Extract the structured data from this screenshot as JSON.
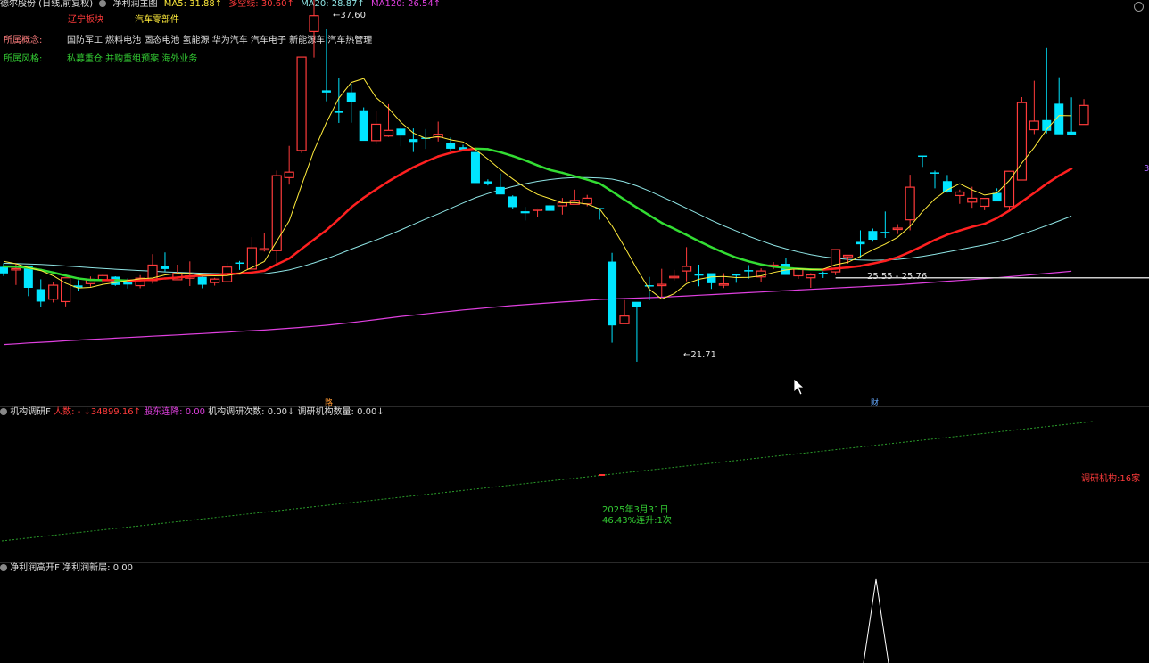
{
  "header": {
    "stock": "德尔股份 (日线,前复权)",
    "indicator": "净利润主图",
    "ma5": "MA5: 31.88↑",
    "duokong": "多空线: 30.60↑",
    "ma20": "MA20: 28.87↑",
    "ma120": "MA120: 26.54↑"
  },
  "tags": {
    "region": "辽宁板块",
    "industry": "汽车零部件"
  },
  "concepts": {
    "label": "所属概念:",
    "value": "国防军工 燃料电池 固态电池 氢能源 华为汽车 汽车电子 新能源车 汽车热管理"
  },
  "styles": {
    "label": "所属风格:",
    "value": "私募重仓 并购重组预案 海外业务"
  },
  "price_labels": {
    "high": "37.60",
    "low": "21.71",
    "range": "25.55 - 25.76",
    "right_axis": "3"
  },
  "markers": {
    "m1": "路",
    "m2": "财"
  },
  "panel2": {
    "title": "机构调研F",
    "renshu": "人数: - ↓34899.16↑",
    "reduce": "股东连降: 0.00",
    "count": "机构调研次数: 0.00↓",
    "num": "调研机构数量: 0.00↓",
    "date": "2025年3月31日",
    "rise": "46.43%连升:1次",
    "inst": "调研机构:16家"
  },
  "panel3": {
    "title": "净利润高开F",
    "value": "净利润新层: 0.00"
  },
  "colors": {
    "up": "#ff3b3b",
    "down": "#00e5ff",
    "ma5": "#ffeb3b",
    "ma10": "#ff2020",
    "ma10_down": "#33dd33",
    "ma20": "#8fe5e5",
    "ma120": "#e040e0"
  },
  "chart_data": {
    "type": "candlestick",
    "candles": [
      [
        26.05,
        26.22,
        25.63,
        25.75
      ],
      [
        25.91,
        26.18,
        25.22,
        25.97
      ],
      [
        26.11,
        26.11,
        24.71,
        25.09
      ],
      [
        25.03,
        25.48,
        24.2,
        24.46
      ],
      [
        24.57,
        25.36,
        24.42,
        25.21
      ],
      [
        24.46,
        25.51,
        24.24,
        25.55
      ],
      [
        25.2,
        25.44,
        24.94,
        25.11
      ],
      [
        25.28,
        25.61,
        25.14,
        25.48
      ],
      [
        25.46,
        25.74,
        25.26,
        25.65
      ],
      [
        25.6,
        25.62,
        25.18,
        25.22
      ],
      [
        25.35,
        25.52,
        25.06,
        25.24
      ],
      [
        25.19,
        25.67,
        25.07,
        25.53
      ],
      [
        25.42,
        26.63,
        25.28,
        26.13
      ],
      [
        26.08,
        26.71,
        25.83,
        25.95
      ],
      [
        25.46,
        26.15,
        25.46,
        25.75
      ],
      [
        25.53,
        26.3,
        25.17,
        25.63
      ],
      [
        25.59,
        25.72,
        25.07,
        25.23
      ],
      [
        25.33,
        25.55,
        25.19,
        25.49
      ],
      [
        25.37,
        26.24,
        25.35,
        26.04
      ],
      [
        26.25,
        26.32,
        25.91,
        26.23
      ],
      [
        25.95,
        27.41,
        25.95,
        26.92
      ],
      [
        26.86,
        27.61,
        26.75,
        26.88
      ],
      [
        26.79,
        30.45,
        26.17,
        30.22
      ],
      [
        30.13,
        31.58,
        29.81,
        30.38
      ],
      [
        31.37,
        34.58,
        31.26,
        35.64
      ],
      [
        36.81,
        38.4,
        35.62,
        37.53
      ],
      [
        34.12,
        36.93,
        33.62,
        34.02
      ],
      [
        33.18,
        34.69,
        32.63,
        33.09
      ],
      [
        34.03,
        34.42,
        32.64,
        33.59
      ],
      [
        33.21,
        33.34,
        31.85,
        31.81
      ],
      [
        31.82,
        33.18,
        31.66,
        32.57
      ],
      [
        32.03,
        33.49,
        31.99,
        32.29
      ],
      [
        32.37,
        32.76,
        31.56,
        32.05
      ],
      [
        31.89,
        32.38,
        31.3,
        31.76
      ],
      [
        31.96,
        32.35,
        31.44,
        31.91
      ],
      [
        31.98,
        32.69,
        31.78,
        32.11
      ],
      [
        31.72,
        31.97,
        31.33,
        31.45
      ],
      [
        31.52,
        31.63,
        31.44,
        31.36
      ],
      [
        31.3,
        31.3,
        29.95,
        29.88
      ],
      [
        29.96,
        30.05,
        29.77,
        29.86
      ],
      [
        29.7,
        30.32,
        29.37,
        29.36
      ],
      [
        29.27,
        29.32,
        28.68,
        28.78
      ],
      [
        28.59,
        28.79,
        28.17,
        28.5
      ],
      [
        28.65,
        28.72,
        28.31,
        28.69
      ],
      [
        28.86,
        28.97,
        28.54,
        28.61
      ],
      [
        28.84,
        29.2,
        28.44,
        28.98
      ],
      [
        28.91,
        29.58,
        28.99,
        29.09
      ],
      [
        28.93,
        29.34,
        28.82,
        29.19
      ],
      [
        28.74,
        28.71,
        28.21,
        28.71
      ],
      [
        26.29,
        26.69,
        22.58,
        23.37
      ],
      [
        23.45,
        24.53,
        23.48,
        23.8
      ],
      [
        24.45,
        24.33,
        21.71,
        24.2
      ],
      [
        25.21,
        25.59,
        24.52,
        25.19
      ],
      [
        25.2,
        25.96,
        24.68,
        25.25
      ],
      [
        25.57,
        25.91,
        25.43,
        25.61
      ],
      [
        25.86,
        26.95,
        25.39,
        26.07
      ],
      [
        25.71,
        26.15,
        25.16,
        25.65
      ],
      [
        25.76,
        25.68,
        25.04,
        25.3
      ],
      [
        25.23,
        25.76,
        25.08,
        25.27
      ],
      [
        25.71,
        25.7,
        25.32,
        25.69
      ],
      [
        25.9,
        26.13,
        25.51,
        25.89
      ],
      [
        25.59,
        25.98,
        25.35,
        25.86
      ],
      [
        26.11,
        26.27,
        25.94,
        26.13
      ],
      [
        26.19,
        26.44,
        25.8,
        25.68
      ],
      [
        25.64,
        25.87,
        25.5,
        25.96
      ],
      [
        25.55,
        25.76,
        25.09,
        25.68
      ],
      [
        25.78,
        25.84,
        25.54,
        25.72
      ],
      [
        25.82,
        26.7,
        25.67,
        26.84
      ],
      [
        26.51,
        26.56,
        26.2,
        26.58
      ],
      [
        27.19,
        27.72,
        26.44,
        27.08
      ],
      [
        27.69,
        27.8,
        27.2,
        27.29
      ],
      [
        27.65,
        28.58,
        27.37,
        27.63
      ],
      [
        27.82,
        28.0,
        27.55,
        27.82
      ],
      [
        28.2,
        30.26,
        27.72,
        29.69
      ],
      [
        31.14,
        31.1,
        30.62,
        31.08
      ],
      [
        30.37,
        30.45,
        29.64,
        30.32
      ],
      [
        29.97,
        30.25,
        29.44,
        29.45
      ],
      [
        29.31,
        29.58,
        28.93,
        29.47
      ],
      [
        29.01,
        29.71,
        28.75,
        29.19
      ],
      [
        28.82,
        29.17,
        28.64,
        29.18
      ],
      [
        29.43,
        29.64,
        29.52,
        29.04
      ],
      [
        28.81,
        30.26,
        28.63,
        30.42
      ],
      [
        30.02,
        33.81,
        30.05,
        33.56
      ],
      [
        32.32,
        34.56,
        32.12,
        32.71
      ],
      [
        32.76,
        36.06,
        32.15,
        32.27
      ],
      [
        33.51,
        34.72,
        32.17,
        32.11
      ],
      [
        32.23,
        33.8,
        32.07,
        32.1
      ],
      [
        32.56,
        33.72,
        32.66,
        33.43
      ]
    ],
    "ma5": [
      26.3,
      26.19,
      26.01,
      25.88,
      25.64,
      25.3,
      25.08,
      25.11,
      25.25,
      25.33,
      25.43,
      25.5,
      25.54,
      25.68,
      25.75,
      25.75,
      25.66,
      25.64,
      25.65,
      25.76,
      26.02,
      26.29,
      27.22,
      28.15,
      29.79,
      31.37,
      32.65,
      33.76,
      34.48,
      34.66,
      33.79,
      33.3,
      32.66,
      32.17,
      31.92,
      32.01,
      31.86,
      31.76,
      31.41,
      30.98,
      30.5,
      30.07,
      29.68,
      29.36,
      29.17,
      28.98,
      28.99,
      28.92,
      28.7,
      27.92,
      26.97,
      25.95,
      25.03,
      24.58,
      24.82,
      25.28,
      25.48,
      25.59,
      25.61,
      25.56,
      25.57,
      25.64,
      25.79,
      25.91,
      25.96,
      25.93,
      25.94,
      26.15,
      26.26,
      26.53,
      26.83,
      27.09,
      27.4,
      27.9,
      28.58,
      29.16,
      29.57,
      29.85,
      29.57,
      29.33,
      29.43,
      30.0,
      30.79,
      31.51,
      32.33,
      32.97,
      32.96
    ],
    "ma10": [
      26.07,
      26.06,
      26.0,
      25.91,
      25.79,
      25.65,
      25.52,
      25.45,
      25.44,
      25.44,
      25.42,
      25.43,
      25.46,
      25.52,
      25.56,
      25.62,
      25.65,
      25.68,
      25.72,
      25.74,
      25.79,
      25.87,
      26.16,
      26.43,
      26.87,
      27.3,
      27.73,
      28.23,
      28.77,
      29.21,
      29.59,
      29.96,
      30.29,
      30.6,
      30.86,
      31.1,
      31.26,
      31.38,
      31.45,
      31.43,
      31.29,
      31.12,
      30.92,
      30.69,
      30.48,
      30.35,
      30.19,
      30.04,
      29.86,
      29.5,
      29.12,
      28.76,
      28.41,
      28.06,
      27.79,
      27.51,
      27.22,
      26.95,
      26.7,
      26.47,
      26.3,
      26.16,
      26.06,
      26.0,
      25.96,
      25.93,
      25.92,
      25.97,
      26.02,
      26.09,
      26.2,
      26.32,
      26.49,
      26.73,
      27.0,
      27.28,
      27.52,
      27.71,
      27.88,
      28.02,
      28.28,
      28.62,
      29.03,
      29.43,
      29.85,
      30.22,
      30.54
    ],
    "ma20": [
      26.21,
      26.2,
      26.18,
      26.16,
      26.13,
      26.09,
      26.05,
      26.01,
      25.98,
      25.94,
      25.91,
      25.88,
      25.85,
      25.82,
      25.8,
      25.78,
      25.76,
      25.74,
      25.73,
      25.72,
      25.72,
      25.73,
      25.81,
      25.91,
      26.06,
      26.23,
      26.42,
      26.63,
      26.86,
      27.07,
      27.28,
      27.5,
      27.74,
      27.99,
      28.24,
      28.47,
      28.72,
      28.97,
      29.21,
      29.4,
      29.57,
      29.72,
      29.85,
      29.96,
      30.04,
      30.1,
      30.13,
      30.13,
      30.11,
      30.06,
      29.94,
      29.75,
      29.52,
      29.26,
      29.0,
      28.73,
      28.46,
      28.18,
      27.92,
      27.69,
      27.45,
      27.24,
      27.04,
      26.88,
      26.73,
      26.61,
      26.51,
      26.44,
      26.39,
      26.36,
      26.35,
      26.36,
      26.39,
      26.45,
      26.53,
      26.62,
      26.73,
      26.84,
      26.95,
      27.06,
      27.18,
      27.35,
      27.54,
      27.73,
      27.94,
      28.15,
      28.37
    ],
    "ma120": [
      22.5,
      22.53,
      22.57,
      22.6,
      22.63,
      22.67,
      22.7,
      22.73,
      22.76,
      22.79,
      22.82,
      22.85,
      22.88,
      22.91,
      22.94,
      22.97,
      23.0,
      23.03,
      23.06,
      23.1,
      23.13,
      23.16,
      23.2,
      23.24,
      23.28,
      23.33,
      23.38,
      23.44,
      23.5,
      23.57,
      23.64,
      23.71,
      23.78,
      23.84,
      23.9,
      23.96,
      24.02,
      24.08,
      24.13,
      24.18,
      24.23,
      24.28,
      24.32,
      24.36,
      24.4,
      24.44,
      24.48,
      24.52,
      24.56,
      24.58,
      24.6,
      24.62,
      24.64,
      24.66,
      24.69,
      24.72,
      24.75,
      24.78,
      24.81,
      24.84,
      24.87,
      24.9,
      24.93,
      24.96,
      24.99,
      25.02,
      25.05,
      25.08,
      25.11,
      25.14,
      25.17,
      25.2,
      25.23,
      25.27,
      25.31,
      25.35,
      25.39,
      25.43,
      25.47,
      25.51,
      25.55,
      25.6,
      25.65,
      25.7,
      25.75,
      25.8,
      25.85
    ],
    "levels": {
      "high": 37.6,
      "low": 21.71,
      "range_low": 25.55,
      "range_high": 25.76
    }
  }
}
